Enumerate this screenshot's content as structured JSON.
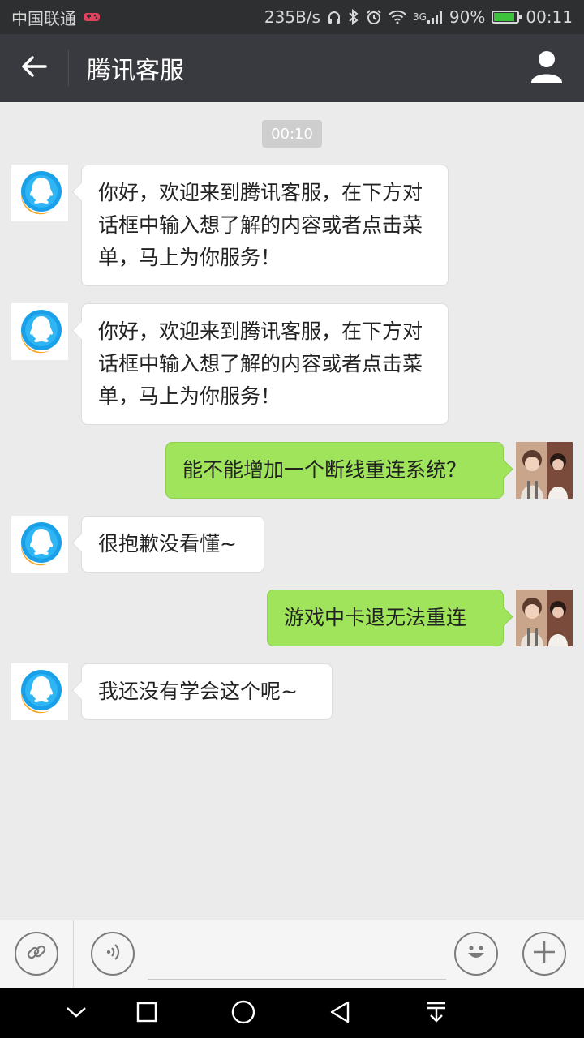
{
  "status_bar": {
    "carrier": "中国联通",
    "net_speed": "235B/s",
    "network_badge": "3G",
    "battery": "90%",
    "battery_level": 0.9,
    "time": "00:11"
  },
  "header": {
    "title": "腾讯客服",
    "back_icon": "arrow-left-icon",
    "profile_icon": "person-icon"
  },
  "chat": {
    "timestamp": "00:10",
    "messages": [
      {
        "from": "service",
        "text": "你好，欢迎来到腾讯客服，在下方对话框中输入想了解的内容或者点击菜单，马上为你服务！"
      },
      {
        "from": "service",
        "text": "你好，欢迎来到腾讯客服，在下方对话框中输入想了解的内容或者点击菜单，马上为你服务！"
      },
      {
        "from": "user",
        "text": "能不能增加一个断线重连系统？"
      },
      {
        "from": "service",
        "text": "很抱歉没看懂~"
      },
      {
        "from": "user",
        "text": "游戏中卡退无法重连"
      },
      {
        "from": "service",
        "text": "我还没有学会这个呢~"
      }
    ]
  },
  "input_bar": {
    "value": "",
    "icons": [
      "link-icon",
      "voice-icon",
      "emoji-icon",
      "plus-icon"
    ]
  },
  "colors": {
    "status_bar_bg": "#2e2f31",
    "title_bar_bg": "#393a3f",
    "chat_bg": "#ebebeb",
    "user_bubble": "#9fe45b",
    "service_bubble": "#ffffff"
  },
  "nav_bar": {
    "icons": [
      "chevron-down-icon",
      "recents-square-icon",
      "home-circle-icon",
      "back-triangle-icon",
      "pull-down-icon"
    ]
  }
}
